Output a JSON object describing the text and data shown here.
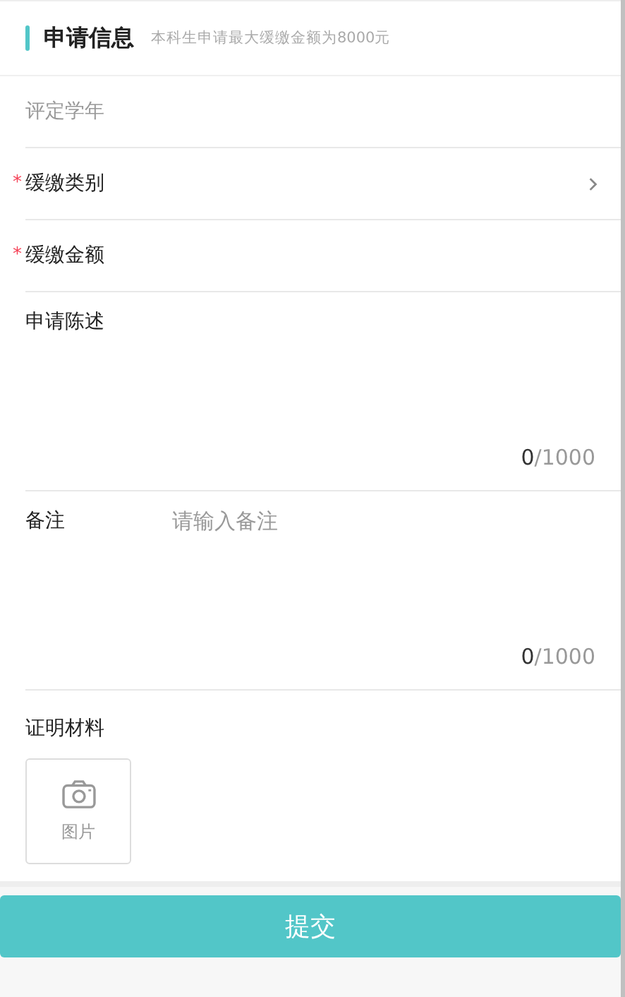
{
  "section": {
    "title": "申请信息",
    "note": "本科生申请最大缓缴金额为8000元"
  },
  "fields": [
    {
      "kind": "select",
      "label": "评定学年",
      "disabled": true,
      "chevron": false
    },
    {
      "kind": "select",
      "label": "缓缴类别",
      "required_mark": "*",
      "disabled": false,
      "chevron": true
    },
    {
      "kind": "input",
      "label": "缓缴金额",
      "required_mark": "*",
      "disabled": false,
      "chevron": false
    },
    {
      "kind": "textarea",
      "label": "申请陈述",
      "count": "0",
      "limit": "/1000"
    },
    {
      "kind": "textarea",
      "label": "备注",
      "placeholder": "请输入备注",
      "count": "0",
      "limit": "/1000"
    }
  ],
  "upload": {
    "label": "证明材料",
    "button": "图片"
  },
  "submit": "提交"
}
